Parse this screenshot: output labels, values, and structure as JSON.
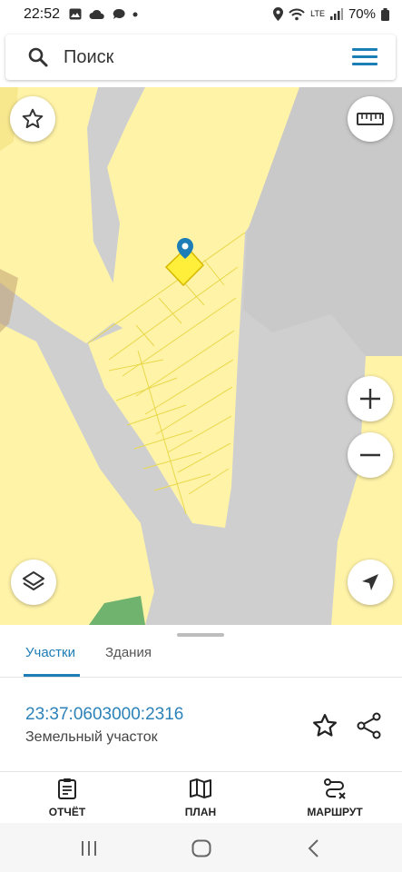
{
  "status_bar": {
    "time": "22:52",
    "network_label": "LTE",
    "battery": "70%"
  },
  "search": {
    "placeholder": "Поиск"
  },
  "map": {
    "background_color": "#cfcfcf",
    "parcel_fill_color": "#fff3a8",
    "selected_fill_color": "#ffef3a",
    "marker_color": "#1d7db6",
    "buttons": [
      "star-icon",
      "ruler-icon",
      "zoom-in-icon",
      "zoom-out-icon",
      "layers-icon",
      "locate-icon"
    ]
  },
  "tabs": {
    "active_label": "Участки",
    "inactive_label": "Здания"
  },
  "parcel": {
    "number": "23:37:0603000:2316",
    "type": "Земельный участок"
  },
  "bottom_nav": {
    "report": "ОТЧЁТ",
    "plan": "ПЛАН",
    "route": "МАРШРУТ"
  },
  "accent_color": "#1d7db6"
}
